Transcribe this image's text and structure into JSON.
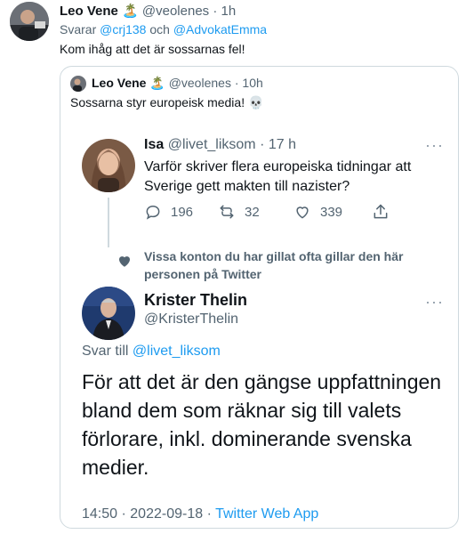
{
  "outer_tweet": {
    "display_name": "Leo Vene",
    "name_emoji": "🏝️",
    "handle": "@veolenes",
    "sep": "·",
    "time": "1h",
    "reply_prefix": "Svarar",
    "reply_to_1": "@crj138",
    "reply_conj": "och",
    "reply_to_2": "@AdvokatEmma",
    "text": "Kom ihåg att det är sossarnas fel!"
  },
  "quoted_tweet": {
    "display_name": "Leo Vene",
    "name_emoji": "🏝️",
    "handle": "@veolenes",
    "sep": "·",
    "time": "10h",
    "text": "Sossarna styr europeisk media! 💀"
  },
  "isa_tweet": {
    "display_name": "Isa",
    "handle": "@livet_liksom",
    "sep": "·",
    "time": "17 h",
    "text": "Varför skriver flera europeiska tidningar att Sverige gett makten till nazister?",
    "replies": "196",
    "retweets": "32",
    "likes": "339"
  },
  "liked_note": {
    "text": "Vissa konton du har gillat ofta gillar den här personen på Twitter"
  },
  "krister_tweet": {
    "display_name": "Krister Thelin",
    "handle": "@KristerThelin",
    "reply_prefix": "Svar till",
    "reply_to": "@livet_liksom",
    "text": "För att det är den gängse uppfattningen bland dem som räknar sig till valets förlorare, inkl. dominerande svenska medier.",
    "time": "14:50",
    "sep": "·",
    "date": "2022-09-18",
    "client": "Twitter Web App"
  },
  "colors": {
    "link": "#1d9bf0",
    "muted": "#536471",
    "text": "#0f1419",
    "border": "#cfd9de"
  },
  "icons": [
    "reply-icon",
    "retweet-icon",
    "like-icon",
    "share-icon",
    "heart-filled-icon",
    "more-icon"
  ]
}
